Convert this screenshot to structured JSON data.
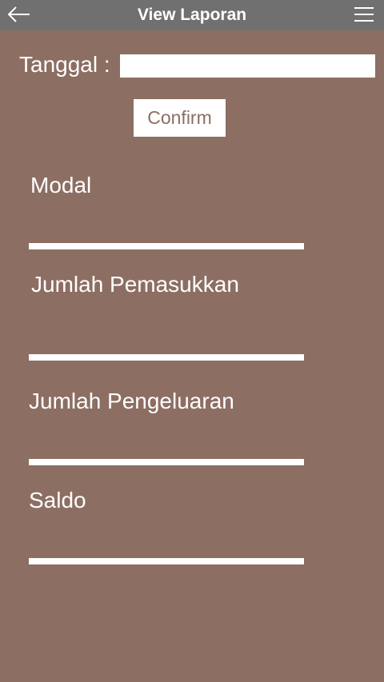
{
  "app_bar": {
    "title": "View Laporan",
    "back_icon": "arrow-left-icon",
    "menu_icon": "hamburger-menu-icon"
  },
  "date_filter": {
    "label": "Tanggal :",
    "value": "",
    "placeholder": ""
  },
  "confirm_button": {
    "label": "Confirm"
  },
  "fields": [
    {
      "label": "Modal",
      "value": ""
    },
    {
      "label": "Jumlah Pemasukkan",
      "value": ""
    },
    {
      "label": "Jumlah Pengeluaran",
      "value": ""
    },
    {
      "label": "Saldo",
      "value": ""
    }
  ],
  "colors": {
    "background": "#8d6e63",
    "app_bar": "#707070",
    "text": "#ffffff"
  }
}
